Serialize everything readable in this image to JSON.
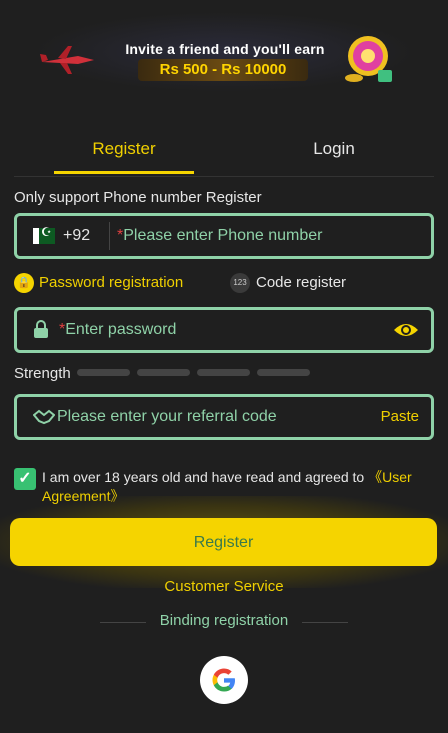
{
  "banner": {
    "title": "Invite a friend and you'll earn",
    "amount": "Rs 500 - Rs 10000"
  },
  "tabs": [
    {
      "label": "Register",
      "active": true
    },
    {
      "label": "Login",
      "active": false
    }
  ],
  "form": {
    "support_note": "Only support Phone number Register",
    "country_code": "+92",
    "phone_placeholder": "Please enter Phone number",
    "required_mark": "*",
    "modes": {
      "password_label": "Password registration",
      "code_label": "Code register",
      "code_icon_text": "123"
    },
    "password_placeholder": "Enter password",
    "strength_label": "Strength",
    "referral_placeholder": "Please enter your referral code",
    "paste_label": "Paste",
    "agreement_text": "I am over 18 years old and have read and agreed to ",
    "agreement_link": "《User Agreement》",
    "agreement_checked": true,
    "register_button": "Register",
    "customer_service": "Customer Service",
    "binding_registration": "Binding registration"
  },
  "colors": {
    "accent": "#f5d400",
    "field_border": "#8fd2a8",
    "background": "#1f1f1f",
    "check": "#38c172"
  }
}
